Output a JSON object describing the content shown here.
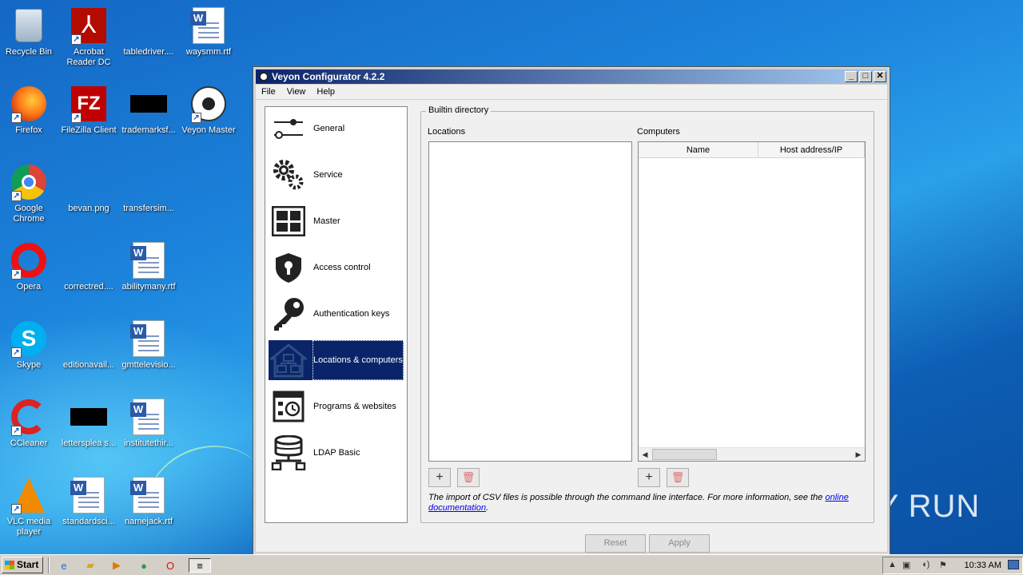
{
  "desktop": {
    "icons": [
      {
        "label": "Recycle Bin"
      },
      {
        "label": "Acrobat Reader DC"
      },
      {
        "label": "tabledriver...."
      },
      {
        "label": "waysmm.rtf"
      },
      {
        "label": "Firefox"
      },
      {
        "label": "FileZilla Client"
      },
      {
        "label": "trademarksf..."
      },
      {
        "label": "Veyon Master"
      },
      {
        "label": "Google Chrome"
      },
      {
        "label": "bevan.png"
      },
      {
        "label": "transfersim..."
      },
      {
        "label": "Opera"
      },
      {
        "label": "correctred...."
      },
      {
        "label": "abilitymany.rtf"
      },
      {
        "label": "Skype"
      },
      {
        "label": "editionavail..."
      },
      {
        "label": "gmttelevisio..."
      },
      {
        "label": "CCleaner"
      },
      {
        "label": "lettersplea s..."
      },
      {
        "label": "institutethir..."
      },
      {
        "label": "VLC media player"
      },
      {
        "label": "standardsci..."
      },
      {
        "label": "namejack.rtf"
      }
    ],
    "watermark": "ANY RUN"
  },
  "window": {
    "title": "Veyon Configurator 4.2.2",
    "menu": [
      "File",
      "View",
      "Help"
    ],
    "nav": [
      {
        "label": "General",
        "icon": "sliders-icon"
      },
      {
        "label": "Service",
        "icon": "gears-icon"
      },
      {
        "label": "Master",
        "icon": "grid-icon"
      },
      {
        "label": "Access control",
        "icon": "shield-lock-icon"
      },
      {
        "label": "Authentication keys",
        "icon": "key-icon"
      },
      {
        "label": "Locations & computers",
        "icon": "house-network-icon"
      },
      {
        "label": "Programs & websites",
        "icon": "programs-icon"
      },
      {
        "label": "LDAP Basic",
        "icon": "database-icon"
      }
    ],
    "selected_nav": "Locations & computers",
    "group_title": "Builtin directory",
    "locations_label": "Locations",
    "computers_label": "Computers",
    "columns": [
      "Name",
      "Host address/IP"
    ],
    "add_symbol": "+",
    "delete_symbol": "🗑",
    "note_text": "The import of CSV files is possible through the command line interface. For more information, see the ",
    "note_link": "online documentation",
    "note_end": ".",
    "reset_label": "Reset",
    "apply_label": "Apply"
  },
  "taskbar": {
    "start_label": "Start",
    "clock": "10:33 AM"
  }
}
